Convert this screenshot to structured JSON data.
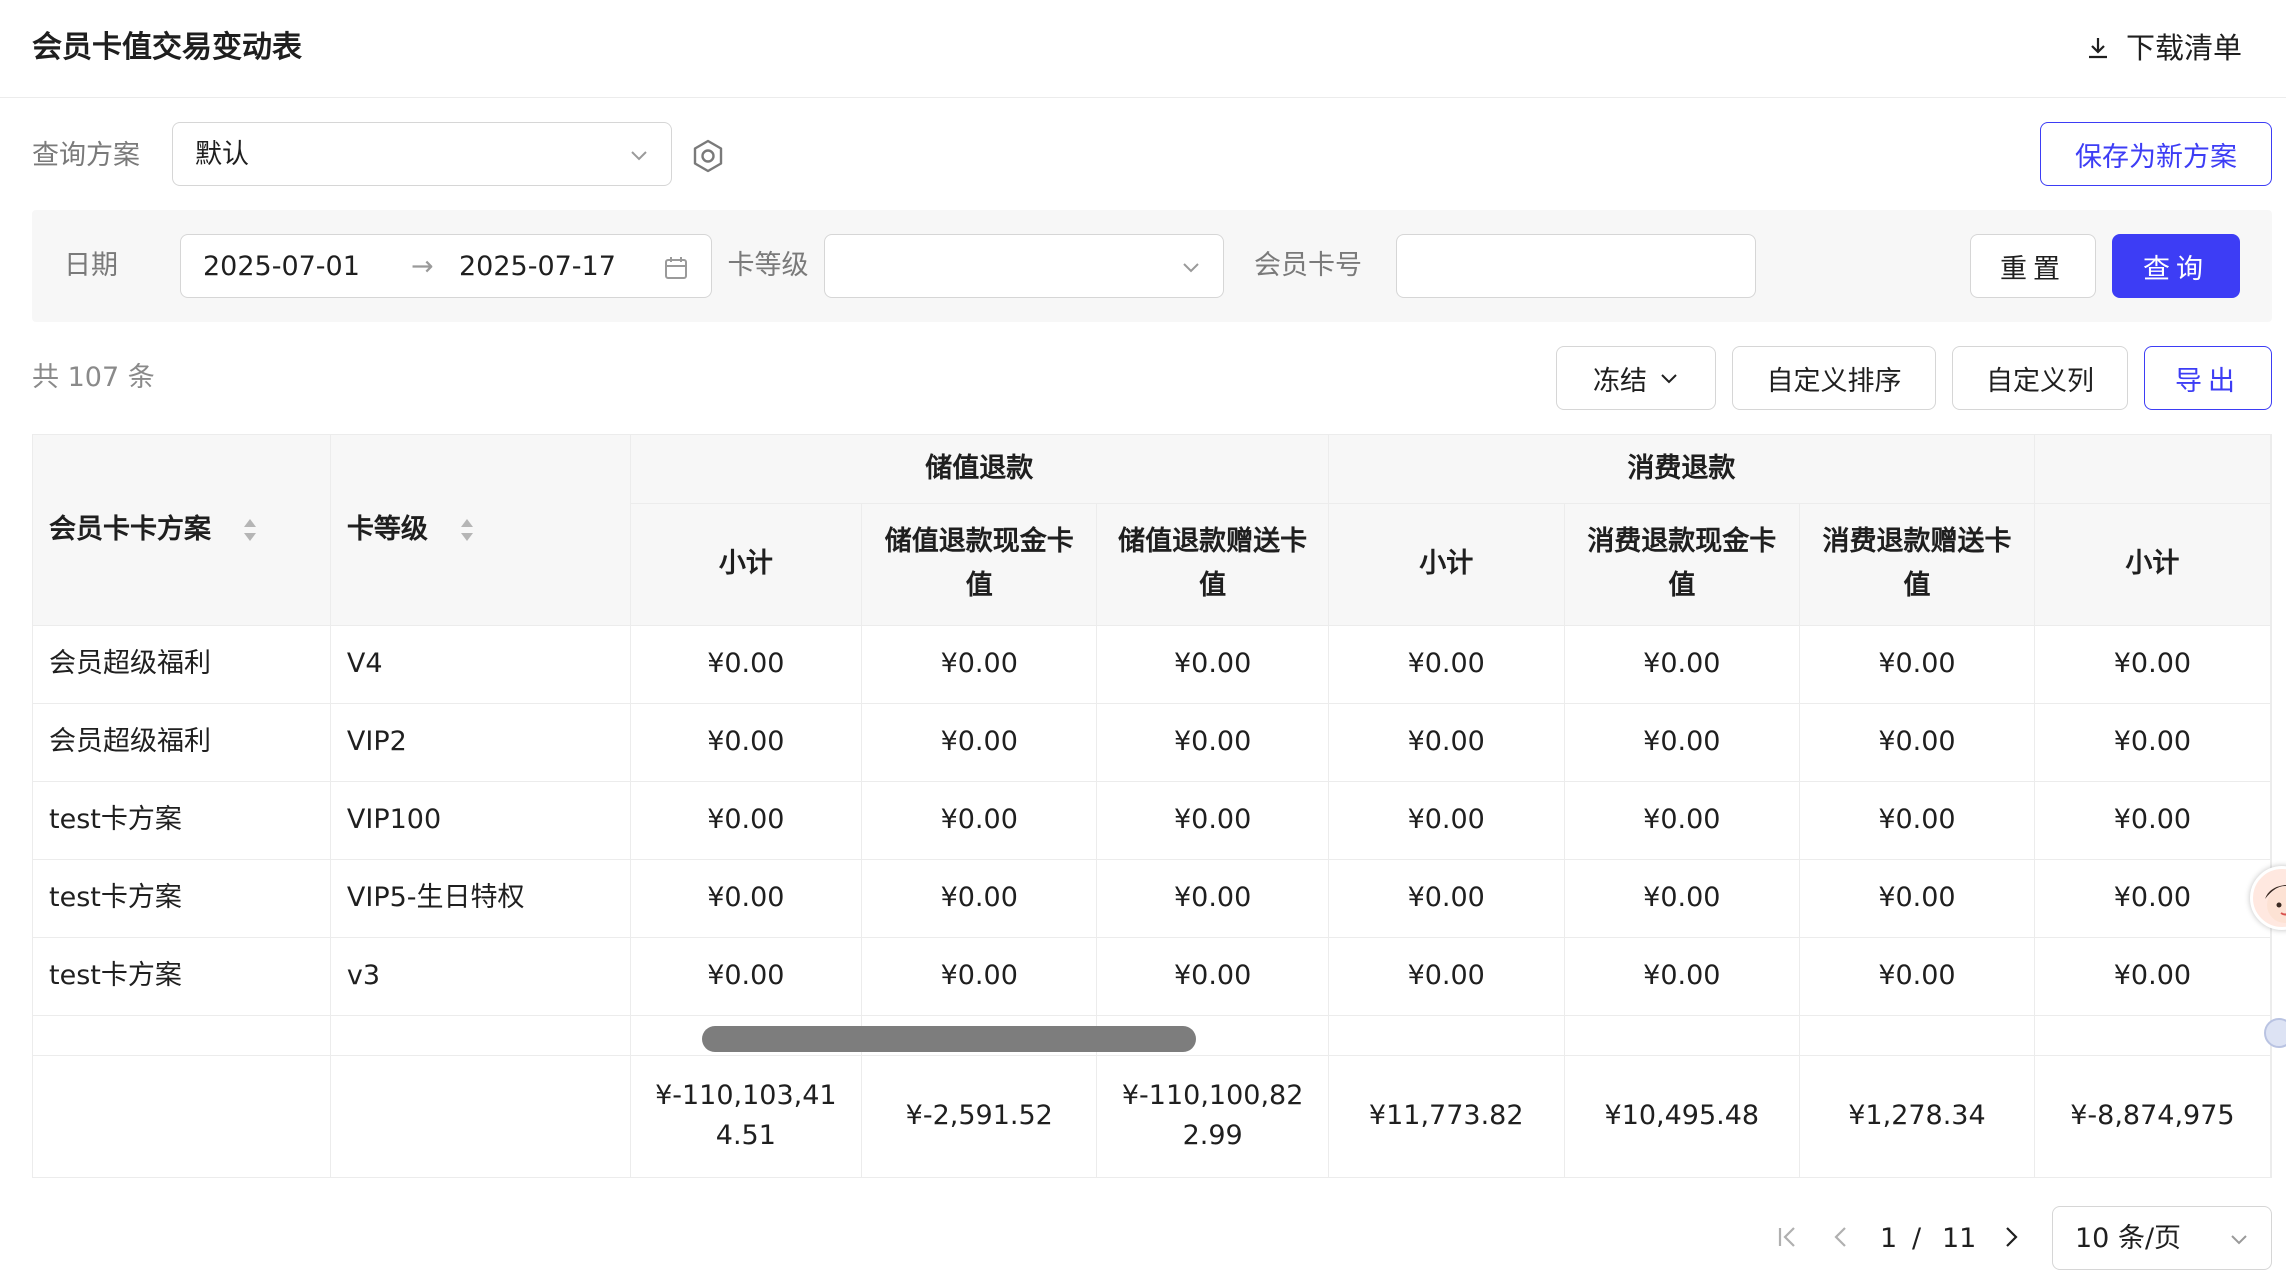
{
  "header": {
    "title": "会员卡值交易变动表",
    "download_label": "下载清单"
  },
  "scheme": {
    "label": "查询方案",
    "value": "默认",
    "save_new_label": "保存为新方案"
  },
  "filters": {
    "date_label": "日期",
    "date_start": "2025-07-01",
    "date_arrow": "→",
    "date_end": "2025-07-17",
    "level_label": "卡等级",
    "card_label": "会员卡号",
    "card_value": "",
    "reset_label": "重置",
    "query_label": "查询"
  },
  "toolbar": {
    "total_text": "共 107 条",
    "freeze_label": "冻结",
    "custom_sort_label": "自定义排序",
    "custom_cols_label": "自定义列",
    "export_label": "导出"
  },
  "table": {
    "col_plan": "会员卡卡方案",
    "col_level": "卡等级",
    "group_store_refund": "储值退款",
    "group_consume_refund": "消费退款",
    "sub_subtotal": "小计",
    "sub_store_cash": "储值退款现金卡值",
    "sub_store_gift": "储值退款赠送卡值",
    "sub_consume_cash": "消费退款现金卡值",
    "sub_consume_gift": "消费退款赠送卡值",
    "rows": [
      {
        "plan": "会员超级福利",
        "level": "V4",
        "v": [
          "¥0.00",
          "¥0.00",
          "¥0.00",
          "¥0.00",
          "¥0.00",
          "¥0.00",
          "¥0.00"
        ]
      },
      {
        "plan": "会员超级福利",
        "level": "VIP2",
        "v": [
          "¥0.00",
          "¥0.00",
          "¥0.00",
          "¥0.00",
          "¥0.00",
          "¥0.00",
          "¥0.00"
        ]
      },
      {
        "plan": "test卡方案",
        "level": "VIP100",
        "v": [
          "¥0.00",
          "¥0.00",
          "¥0.00",
          "¥0.00",
          "¥0.00",
          "¥0.00",
          "¥0.00"
        ]
      },
      {
        "plan": "test卡方案",
        "level": "VIP5-生日特权",
        "v": [
          "¥0.00",
          "¥0.00",
          "¥0.00",
          "¥0.00",
          "¥0.00",
          "¥0.00",
          "¥0.00"
        ]
      },
      {
        "plan": "test卡方案",
        "level": "v3",
        "v": [
          "¥0.00",
          "¥0.00",
          "¥0.00",
          "¥0.00",
          "¥0.00",
          "¥0.00",
          "¥0.00"
        ]
      }
    ],
    "summary": [
      "¥-110,103,414.51",
      "¥-2,591.52",
      "¥-110,100,822.99",
      "¥11,773.82",
      "¥10,495.48",
      "¥1,278.34",
      "¥-8,874,975"
    ]
  },
  "pagination": {
    "current": "1",
    "separator": "/",
    "total_pages": "11",
    "page_size": "10 条/页"
  },
  "colors": {
    "primary": "#3d3df5",
    "header_bg": "#f7f7f7",
    "border": "#ececec"
  }
}
